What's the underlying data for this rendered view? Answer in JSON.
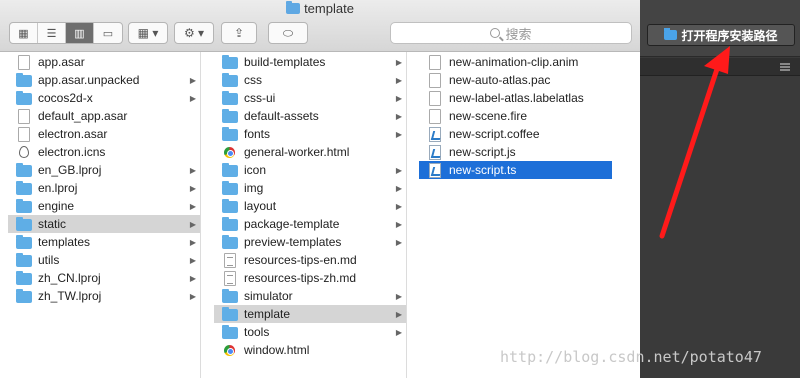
{
  "window": {
    "title": "template"
  },
  "search": {
    "placeholder": "搜索"
  },
  "right_panel": {
    "open_button_label": "打开程序安装路径"
  },
  "columns": [
    {
      "items": [
        {
          "name": "app.asar",
          "type": "doc",
          "chevron": false,
          "selected": ""
        },
        {
          "name": "app.asar.unpacked",
          "type": "folder",
          "chevron": true,
          "selected": ""
        },
        {
          "name": "cocos2d-x",
          "type": "folder",
          "chevron": true,
          "selected": ""
        },
        {
          "name": "default_app.asar",
          "type": "doc",
          "chevron": false,
          "selected": ""
        },
        {
          "name": "electron.asar",
          "type": "doc",
          "chevron": false,
          "selected": ""
        },
        {
          "name": "electron.icns",
          "type": "icns",
          "chevron": false,
          "selected": ""
        },
        {
          "name": "en_GB.lproj",
          "type": "folder",
          "chevron": true,
          "selected": ""
        },
        {
          "name": "en.lproj",
          "type": "folder",
          "chevron": true,
          "selected": ""
        },
        {
          "name": "engine",
          "type": "folder",
          "chevron": true,
          "selected": ""
        },
        {
          "name": "static",
          "type": "folder",
          "chevron": true,
          "selected": "gray"
        },
        {
          "name": "templates",
          "type": "folder",
          "chevron": true,
          "selected": ""
        },
        {
          "name": "utils",
          "type": "folder",
          "chevron": true,
          "selected": ""
        },
        {
          "name": "zh_CN.lproj",
          "type": "folder",
          "chevron": true,
          "selected": ""
        },
        {
          "name": "zh_TW.lproj",
          "type": "folder",
          "chevron": true,
          "selected": ""
        }
      ]
    },
    {
      "items": [
        {
          "name": "build-templates",
          "type": "folder",
          "chevron": true,
          "selected": ""
        },
        {
          "name": "css",
          "type": "folder",
          "chevron": true,
          "selected": ""
        },
        {
          "name": "css-ui",
          "type": "folder",
          "chevron": true,
          "selected": ""
        },
        {
          "name": "default-assets",
          "type": "folder",
          "chevron": true,
          "selected": ""
        },
        {
          "name": "fonts",
          "type": "folder",
          "chevron": true,
          "selected": ""
        },
        {
          "name": "general-worker.html",
          "type": "chrome",
          "chevron": false,
          "selected": ""
        },
        {
          "name": "icon",
          "type": "folder",
          "chevron": true,
          "selected": ""
        },
        {
          "name": "img",
          "type": "folder",
          "chevron": true,
          "selected": ""
        },
        {
          "name": "layout",
          "type": "folder",
          "chevron": true,
          "selected": ""
        },
        {
          "name": "package-template",
          "type": "folder",
          "chevron": true,
          "selected": ""
        },
        {
          "name": "preview-templates",
          "type": "folder",
          "chevron": true,
          "selected": ""
        },
        {
          "name": "resources-tips-en.md",
          "type": "md",
          "chevron": false,
          "selected": ""
        },
        {
          "name": "resources-tips-zh.md",
          "type": "md",
          "chevron": false,
          "selected": ""
        },
        {
          "name": "simulator",
          "type": "folder",
          "chevron": true,
          "selected": ""
        },
        {
          "name": "template",
          "type": "folder",
          "chevron": true,
          "selected": "gray"
        },
        {
          "name": "tools",
          "type": "folder",
          "chevron": true,
          "selected": ""
        },
        {
          "name": "window.html",
          "type": "chrome",
          "chevron": false,
          "selected": ""
        }
      ]
    },
    {
      "items": [
        {
          "name": "new-animation-clip.anim",
          "type": "doc",
          "chevron": false,
          "selected": ""
        },
        {
          "name": "new-auto-atlas.pac",
          "type": "doc",
          "chevron": false,
          "selected": ""
        },
        {
          "name": "new-label-atlas.labelatlas",
          "type": "doc",
          "chevron": false,
          "selected": ""
        },
        {
          "name": "new-scene.fire",
          "type": "doc",
          "chevron": false,
          "selected": ""
        },
        {
          "name": "new-script.coffee",
          "type": "vscode",
          "chevron": false,
          "selected": ""
        },
        {
          "name": "new-script.js",
          "type": "vscode",
          "chevron": false,
          "selected": ""
        },
        {
          "name": "new-script.ts",
          "type": "vscode",
          "chevron": false,
          "selected": "blue"
        }
      ]
    }
  ],
  "watermark": "http://blog.csdn.net/potato47",
  "colors": {
    "accent_select": "#1d6fd8",
    "arrow_annotation": "#ff1a1a"
  }
}
